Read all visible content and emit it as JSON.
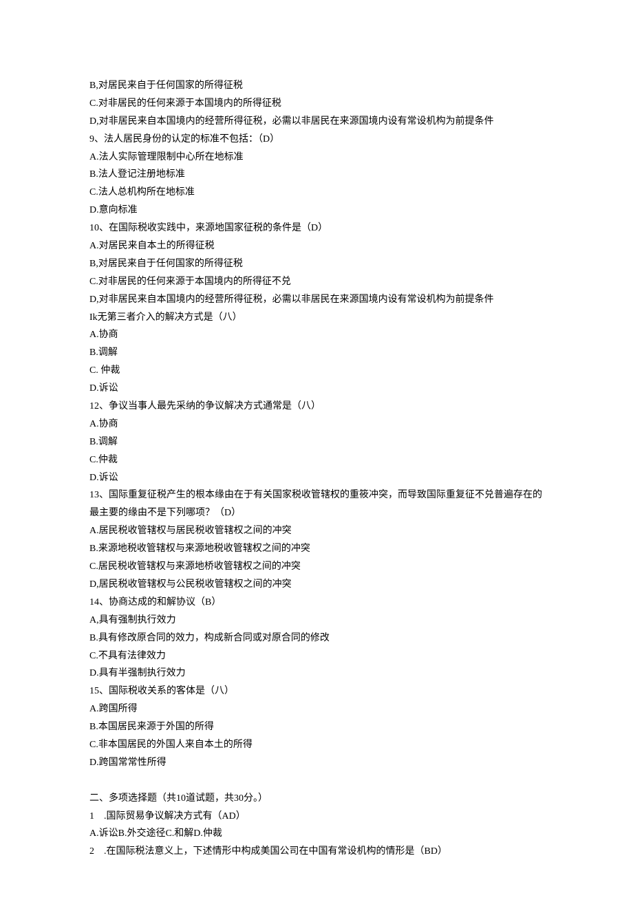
{
  "lines": [
    "B,对居民来自于任何国家的所得征税",
    "C.对非居民的任何来源于本国境内的所得征税",
    "D,对非居民来自本国境内的经营所得征税，必需以非居民在来源国境内设有常设机构为前提条件",
    "9、法人居民身份的认定的标准不包括：（D）",
    "A.法人实际管理限制中心所在地标准",
    "B.法人登记注册地标准",
    "C.法人总机构所在地标准",
    "D.意向标准",
    "10、在国际税收实践中，来源地国家征税的条件是（D）",
    "A.对居民来自本土的所得征税",
    "B,对居民来自于任何国家的所得征税",
    "C.对非居民的任何来源于本国境内的所得征不兑",
    "D,对非居民来自本国境内的经营所得征税，必需以非居民在来源国境内设有常设机构为前提条件",
    "Ik无第三者介入的解决方式是（八）",
    "A.协商",
    "B.调解",
    "C. 仲裁",
    "D.诉讼",
    "12、争议当事人最先采纳的争议解决方式通常是（八）",
    "A.协商",
    "B.调解",
    "C.仲裁",
    "D.诉讼",
    "13、国际重复征税产生的根本缘由在于有关国家税收管辖权的重筱冲突，而导致国际重复征不兑普遍存在的最主要的缘由不是下列哪项？（D）",
    "A.居民税收管辖权与居民税收管辖权之间的冲突",
    "B.来源地税收管辖权与来源地税收管辖权之间的冲突",
    "C.居民税收管辖权与来源地桥收管辖权之间的冲突",
    "D,居民税收管辖权与公民税收管辖权之间的冲突",
    "14、协商达成的和解协议（B）",
    "A,具有强制执行效力",
    "B.具有修改原合同的效力，构成新合同或对原合同的修改",
    "C.不具有法律效力",
    "D.具有半强制执行效力",
    "15、国际税收关系的客体是（八）",
    "A.跨国所得",
    "B.本国居民来源于外国的所得",
    "C.非本国居民的外国人来自本土的所得",
    "D.跨国常常性所得",
    "",
    "二、多项选择题（共10道试题，共30分。）",
    "1　.国际贸易争议解决方式有（AD）",
    "A.诉讼B.外交途径C.和解D.仲裁",
    "2　.在国际税法意义上，下述情形中构成美国公司在中国有常设机构的情形是（BD）"
  ]
}
